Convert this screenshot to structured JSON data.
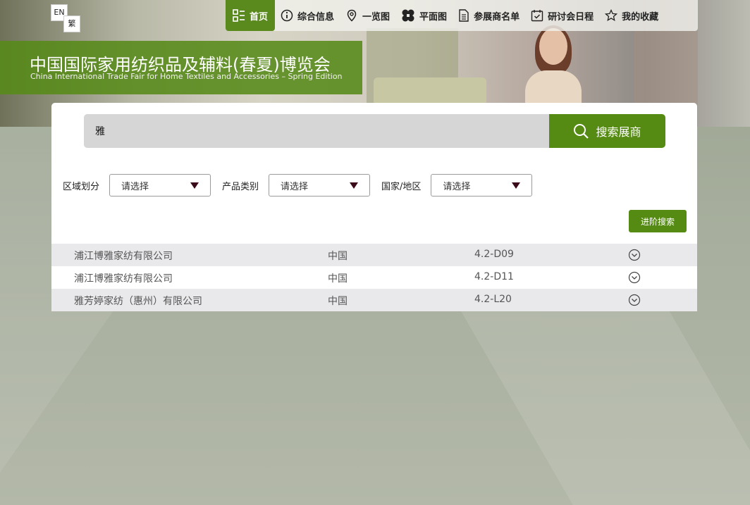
{
  "lang": {
    "en": "EN",
    "traditional": "繁"
  },
  "nav": {
    "items": [
      {
        "label": "首页",
        "icon": "home-grid-icon",
        "active": true
      },
      {
        "label": "综合信息",
        "icon": "info-circle-icon"
      },
      {
        "label": "一览图",
        "icon": "map-pin-icon"
      },
      {
        "label": "平面图",
        "icon": "floorplan-icon"
      },
      {
        "label": "参展商名单",
        "icon": "document-icon"
      },
      {
        "label": "研讨会日程",
        "icon": "calendar-check-icon"
      },
      {
        "label": "我的收藏",
        "icon": "star-icon"
      }
    ]
  },
  "header": {
    "title_cn": "中国国际家用纺织品及辅料(春夏)博览会",
    "title_en": "China International Trade Fair for Home Textiles and Accessories – Spring Edition"
  },
  "search": {
    "value": "雅",
    "button_label": "搜索展商"
  },
  "filters": [
    {
      "label": "区域划分",
      "selected": "请选择"
    },
    {
      "label": "产品类别",
      "selected": "请选择"
    },
    {
      "label": "国家/地区",
      "selected": "请选择"
    }
  ],
  "advanced_search_label": "进阶搜索",
  "results": [
    {
      "company": "浦江博雅家纺有限公司",
      "country": "中国",
      "booth": "4.2-D09"
    },
    {
      "company": "浦江博雅家纺有限公司",
      "country": "中国",
      "booth": "4.2-D11"
    },
    {
      "company": "雅芳婷家纺（惠州）有限公司",
      "country": "中国",
      "booth": "4.2-L20"
    }
  ],
  "colors": {
    "accent": "#558b12",
    "row_alt": "#e9e8ea",
    "arrow": "#3b0a1a"
  }
}
